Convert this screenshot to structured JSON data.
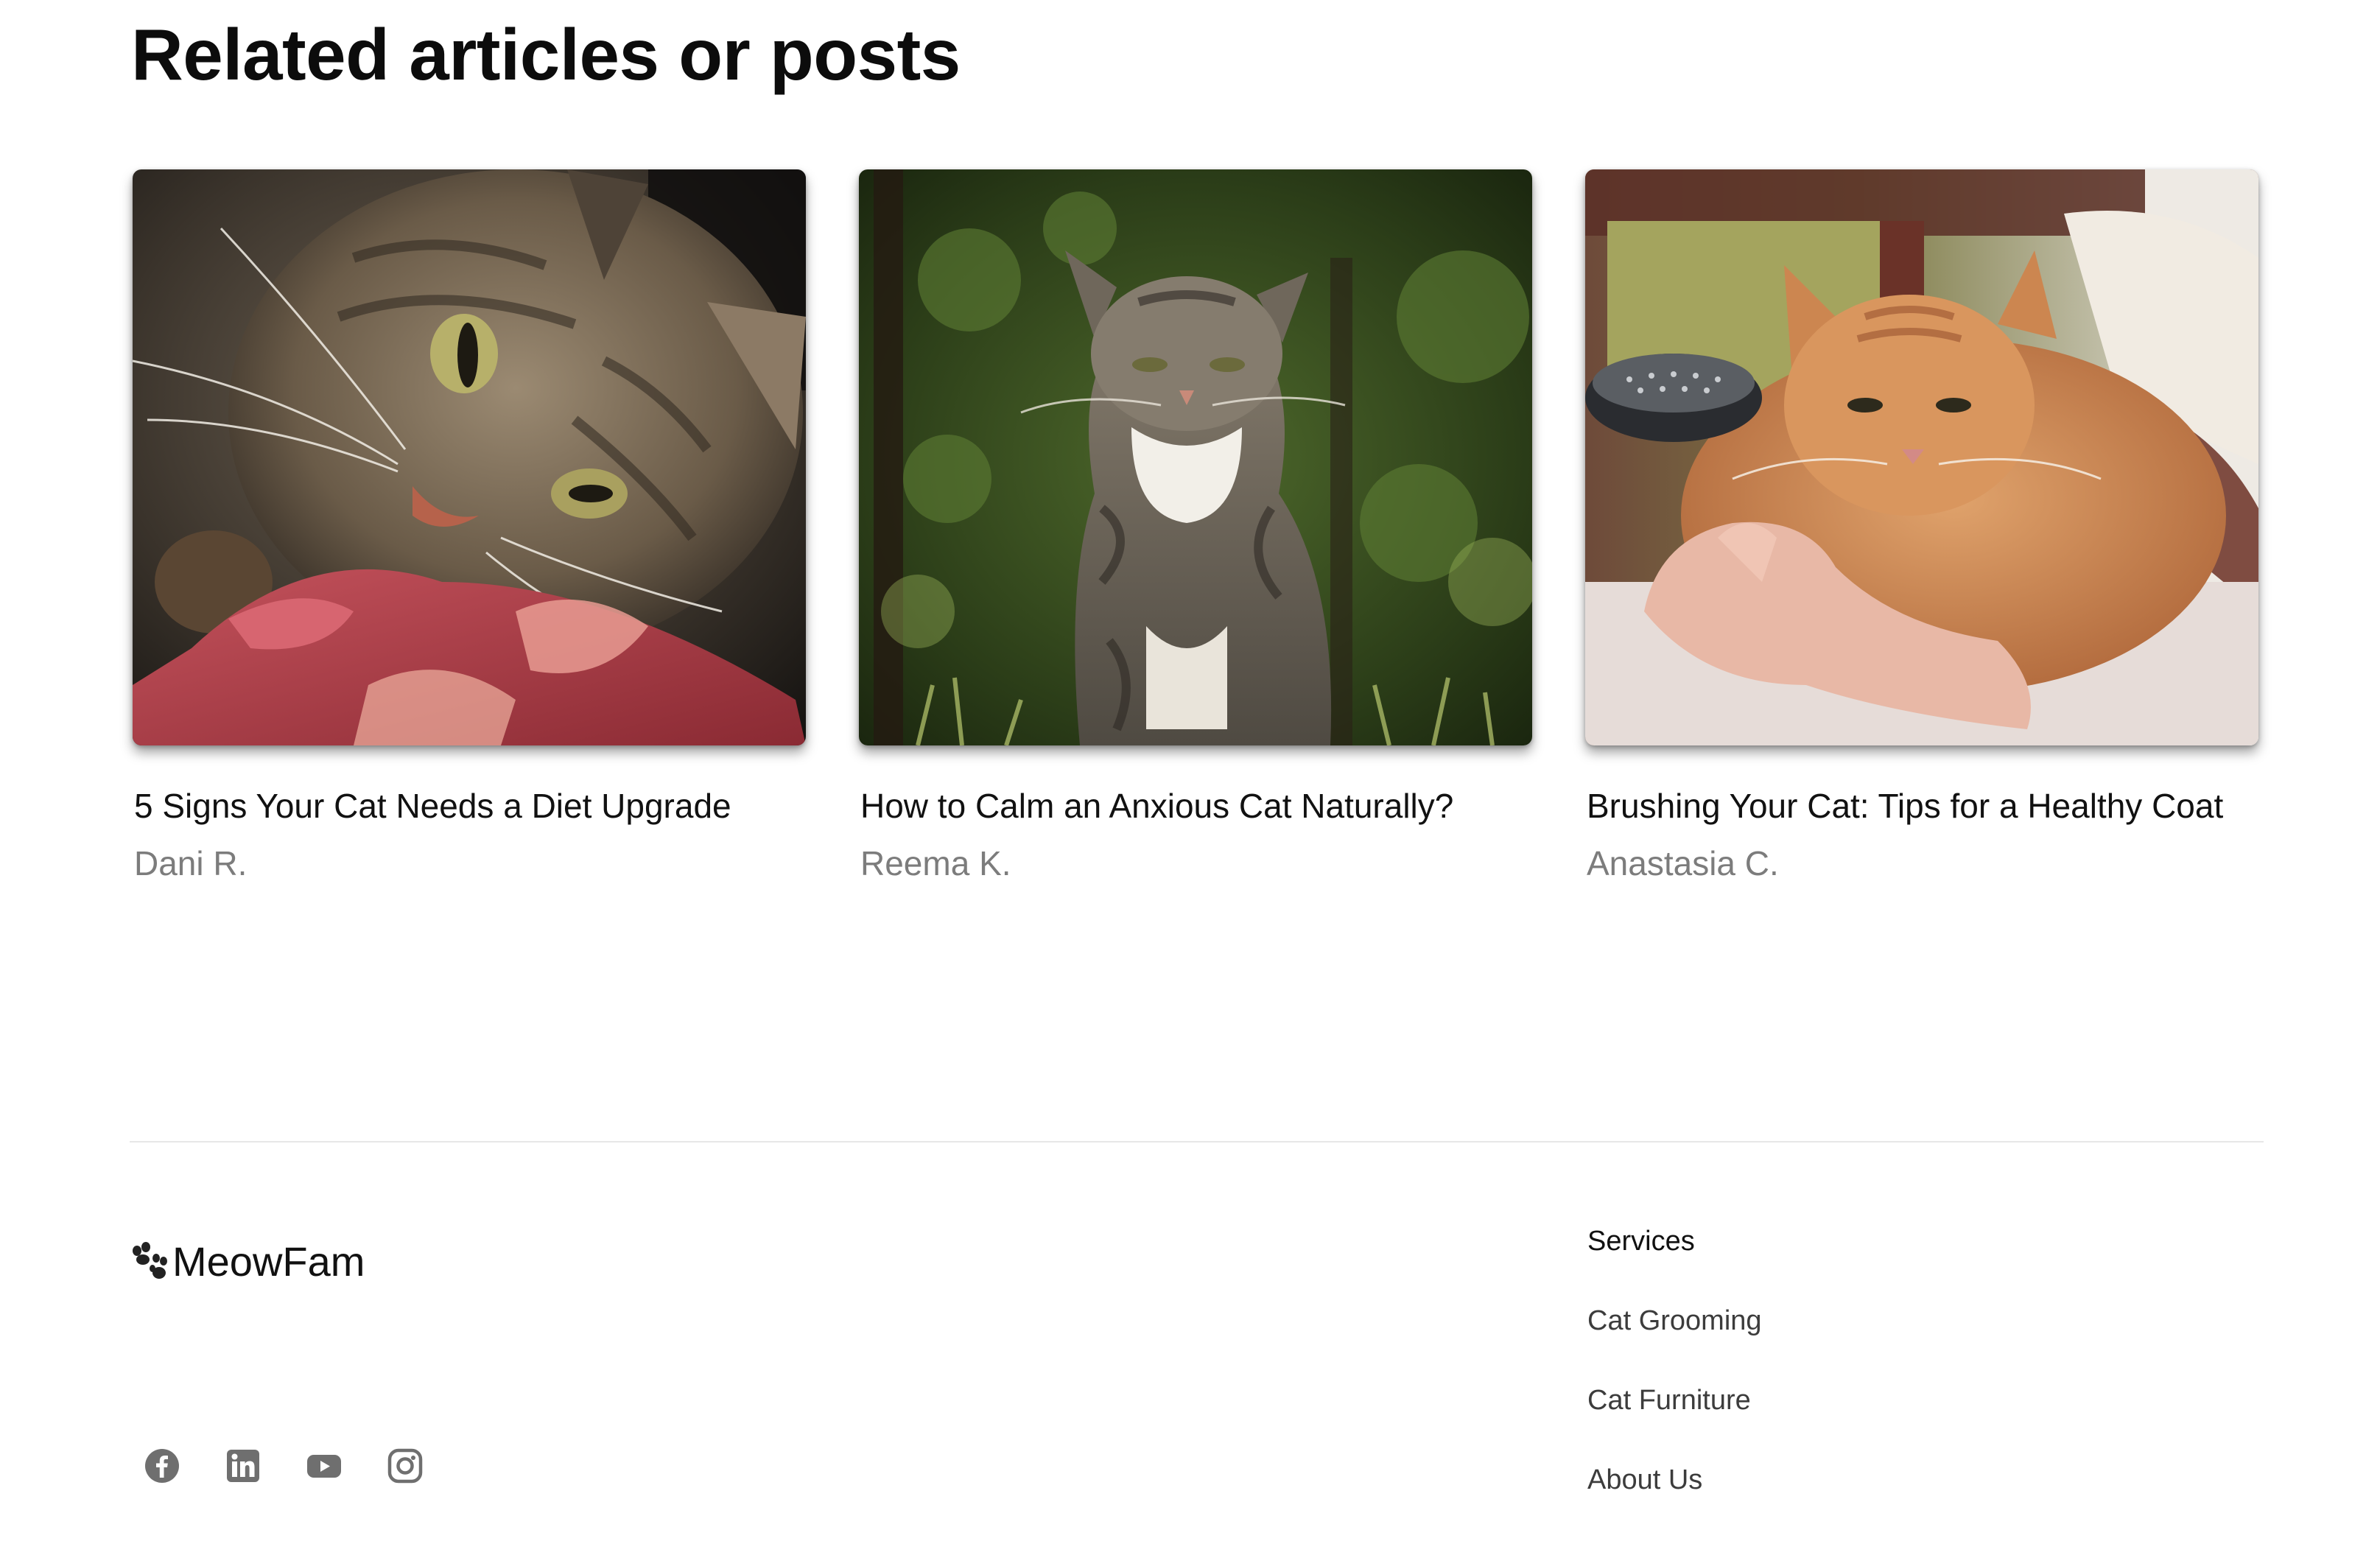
{
  "related": {
    "heading": "Related articles or posts",
    "cards": [
      {
        "title": "5 Signs Your Cat Needs a Diet Upgrade",
        "author": "Dani R.",
        "image_icon": "tabby-cat-eating-image"
      },
      {
        "title": "How to Calm an Anxious Cat Naturally?",
        "author": "Reema K.",
        "image_icon": "tabby-cat-outdoors-image"
      },
      {
        "title": "Brushing Your Cat: Tips for a Healthy Coat",
        "author": "Anastasia C.",
        "image_icon": "ginger-cat-brushing-image"
      }
    ]
  },
  "footer": {
    "brand": "MeowFam",
    "brand_icon": "paw-icon",
    "socials": [
      {
        "name": "facebook-icon"
      },
      {
        "name": "linkedin-icon"
      },
      {
        "name": "youtube-icon"
      },
      {
        "name": "instagram-icon"
      }
    ],
    "services": {
      "title": "Services",
      "links": [
        "Cat Grooming",
        "Cat Furniture",
        "About Us"
      ]
    }
  },
  "colors": {
    "text": "#111111",
    "muted": "#7c7c7c",
    "divider": "#e7e7e7",
    "icon": "#6f6f6f"
  }
}
